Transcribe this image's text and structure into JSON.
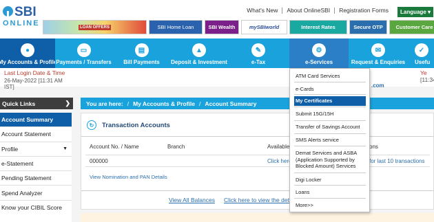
{
  "logo": {
    "brand": "SBI",
    "sub": "ONLINE"
  },
  "top_links": [
    "What's New",
    "About OnlineSBI",
    "Registration Forms"
  ],
  "language": "Language ▾",
  "banners": {
    "promo": "LOAN OFFERS",
    "home_loan": "SBI Home Loan",
    "wealth": "SBI Wealth",
    "sbiworld": "mySBIworld",
    "interest_rates": "Interest Rates",
    "secure_otp": "Secure OTP",
    "customer_care": "Customer Care"
  },
  "nav": [
    {
      "label": "My Accounts & Profile",
      "icon": "person-icon"
    },
    {
      "label": "Payments / Transfers",
      "icon": "wallet-icon"
    },
    {
      "label": "Bill Payments",
      "icon": "bill-icon"
    },
    {
      "label": "Deposit & Investment",
      "icon": "investment-icon"
    },
    {
      "label": "e-Tax",
      "icon": "tax-icon"
    },
    {
      "label": "e-Services",
      "icon": "services-icon"
    },
    {
      "label": "Request & Enquiries",
      "icon": "request-icon"
    },
    {
      "label": "Usefu",
      "icon": "useful-icon"
    }
  ],
  "last_login": {
    "title": "Last Login Date & Time",
    "value": "26-May-2022 [11:31 AM IST]",
    "right_title": "Ye",
    "right_value": "[11:34",
    "email_suffix": ".com"
  },
  "quick_links": {
    "title": "Quick Links",
    "items": [
      "Account Summary",
      "Account Statement",
      "Profile",
      "e-Statement",
      "Pending Statement",
      "Spend Analyzer",
      "Know your CIBIL Score"
    ]
  },
  "breadcrumb": {
    "prefix": "You are here:",
    "items": [
      "My Accounts & Profile",
      "Account Summary"
    ]
  },
  "transaction": {
    "title": "Transaction Accounts",
    "columns": [
      "Account No. / Name",
      "Branch",
      "Available",
      "ons"
    ],
    "account_no": "000000",
    "click_here": "Click here",
    "last_txn": "for last 10 transactions",
    "view_nomination": "View Nomination and PAN Details",
    "view_all": "View All Balances",
    "click_detail": "Click here to view the deta"
  },
  "eservices_menu": [
    "ATM Card Services",
    "e-Cards",
    "My Certificates",
    "Submit 15G/15H",
    "Transfer of Savings Account",
    "SMS Alerts service",
    "Demat Services and ASBA (Application Supported by Blocked Amount) Services",
    "Digi Locker",
    "Loans",
    "More>>"
  ],
  "colors": {
    "nav": "#1aa2dc",
    "active": "#0e5ea8",
    "accent_red": "#c0392b"
  }
}
